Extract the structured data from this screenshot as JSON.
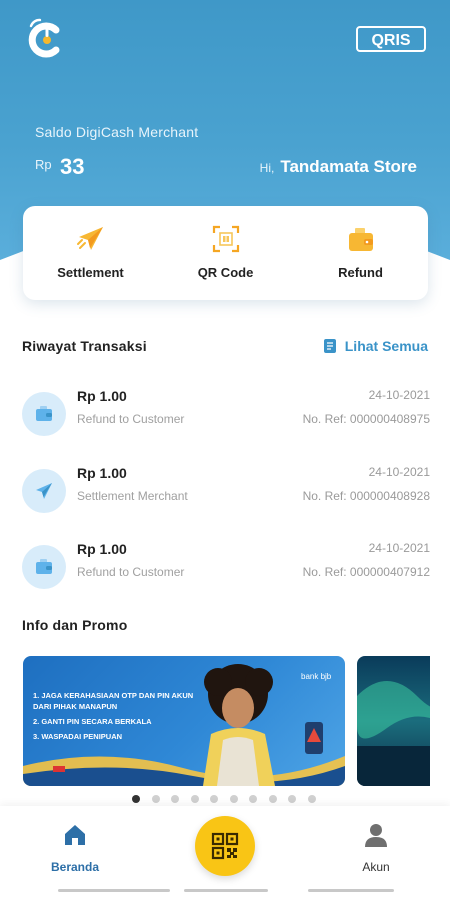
{
  "header": {
    "saldo_label": "Saldo DigiCash Merchant",
    "currency": "Rp",
    "balance": "33",
    "greeting": "Hi,",
    "store_name": "Tandamata Store"
  },
  "menu": [
    {
      "label": "Settlement",
      "icon": "paper-plane-icon"
    },
    {
      "label": "QR Code",
      "icon": "qr-scan-icon"
    },
    {
      "label": "Refund",
      "icon": "wallet-icon"
    }
  ],
  "transactions": {
    "title": "Riwayat Transaksi",
    "see_all": "Lihat Semua",
    "items": [
      {
        "amount": "Rp 1.00",
        "type": "Refund to Customer",
        "date": "24-10-2021",
        "ref": "No. Ref: 000000408975",
        "icon": "wallet-icon"
      },
      {
        "amount": "Rp 1.00",
        "type": "Settlement Merchant",
        "date": "24-10-2021",
        "ref": "No. Ref: 000000408928",
        "icon": "paper-plane-icon"
      },
      {
        "amount": "Rp 1.00",
        "type": "Refund to Customer",
        "date": "24-10-2021",
        "ref": "No. Ref: 000000407912",
        "icon": "wallet-icon"
      }
    ]
  },
  "promo": {
    "title": "Info dan Promo",
    "banner1_lines": [
      "JAGA KERAHASIAAN OTP DAN PIN AKUN DARI PIHAK MANAPUN",
      "GANTI PIN SECARA BERKALA",
      "WASPADAI PENIPUAN"
    ],
    "banner1_brand": "bank bjb",
    "dots_total": 10,
    "dots_active": 0
  },
  "nav": {
    "home": "Beranda",
    "account": "Akun"
  },
  "colors": {
    "header": "#4aa2d0",
    "accent": "#3a93c8",
    "fab": "#f9c515",
    "icon_orange": "#f5a623"
  }
}
